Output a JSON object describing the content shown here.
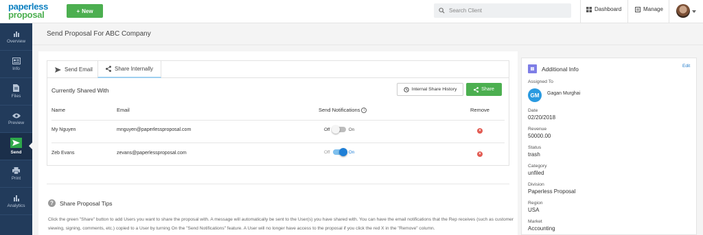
{
  "topbar": {
    "logo_line1": "paperless",
    "logo_line2": "proposal",
    "new_button": "New",
    "search_placeholder": "Search Client",
    "dashboard": "Dashboard",
    "manage": "Manage"
  },
  "sidebar": {
    "items": [
      {
        "label": "Overview",
        "icon": "bar-chart-icon"
      },
      {
        "label": "Info",
        "icon": "id-card-icon"
      },
      {
        "label": "Files",
        "icon": "file-icon"
      },
      {
        "label": "Preview",
        "icon": "eye-icon"
      },
      {
        "label": "Send",
        "icon": "send-icon",
        "active": true
      },
      {
        "label": "Print",
        "icon": "printer-icon"
      },
      {
        "label": "Analytics",
        "icon": "analytics-icon"
      }
    ]
  },
  "page": {
    "title": "Send Proposal For ABC Company"
  },
  "tabs": [
    {
      "label": "Send Email",
      "icon": "paper-plane-icon"
    },
    {
      "label": "Share Internally",
      "icon": "share-icon",
      "active": true
    }
  ],
  "shared": {
    "title": "Currently Shared With",
    "history_button": "Internal Share History",
    "share_button": "Share",
    "columns": {
      "name": "Name",
      "email": "Email",
      "notifications": "Send Notifications",
      "remove": "Remove"
    },
    "toggle_off": "Off",
    "toggle_on": "On",
    "rows": [
      {
        "name": "My Nguyen",
        "email": "mnguyen@paperlessproposal.com",
        "notifications": "Off"
      },
      {
        "name": "Zeb Evans",
        "email": "zevans@paperlessproposal.com",
        "notifications": "On"
      }
    ]
  },
  "tips": {
    "title": "Share Proposal Tips",
    "text": "Click the green \"Share\" button to add Users you want to share the proposal with. A message will automatically be sent to the User(s) you have shared with. You can have the email notifications that the Rep receives (such as customer viewing, signing, comments, etc.) copied to a User by turning On the \"Send Notifications\" feature. A User will no longer have access to the proposal if you click the red X in the \"Remove\" column."
  },
  "info": {
    "title": "Additional Info",
    "edit": "Edit",
    "assigned_label": "Assigned To",
    "assigned_initials": "GM",
    "assigned_name": "Gagan Murghai",
    "fields": [
      {
        "label": "Date",
        "value": "02/20/2018"
      },
      {
        "label": "Revenue",
        "value": "50000.00"
      },
      {
        "label": "Status",
        "value": "trash"
      },
      {
        "label": "Category",
        "value": "unfiled"
      },
      {
        "label": "Division",
        "value": "Paperless Proposal"
      },
      {
        "label": "Region",
        "value": "USA"
      },
      {
        "label": "Market",
        "value": "Accounting"
      }
    ]
  },
  "colors": {
    "brand_blue": "#0b7fc0",
    "brand_green": "#4caf50",
    "sidebar": "#223b5b",
    "remove_red": "#e25950",
    "toggle_on": "#1f7fd6"
  }
}
